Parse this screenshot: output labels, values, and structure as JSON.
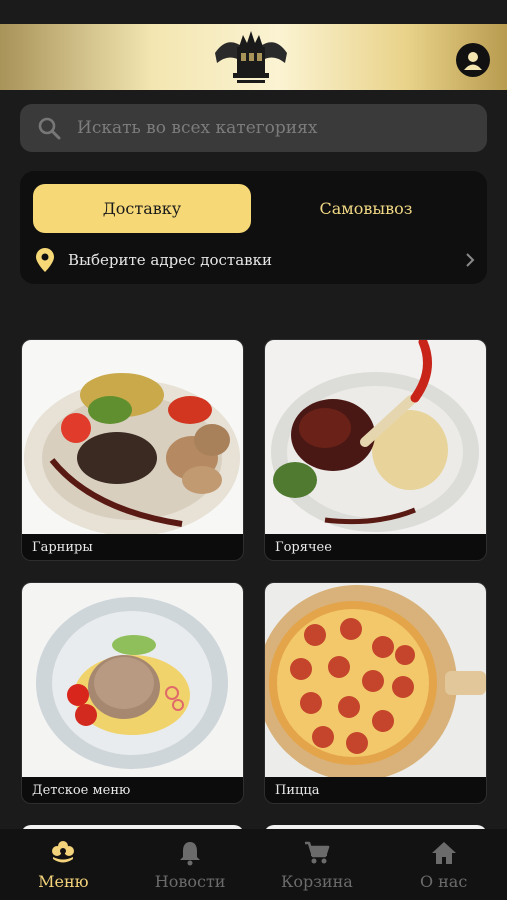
{
  "header": {
    "brand_logo": "crown-castle-logo",
    "profile_icon": "account-circle-icon"
  },
  "search": {
    "placeholder": "Искать во всех категориях",
    "icon": "search-icon"
  },
  "delivery": {
    "tab_delivery": "Доставку",
    "tab_pickup": "Самовывоз",
    "active_tab": "delivery",
    "address_prompt": "Выберите адрес доставки"
  },
  "categories": [
    {
      "label": "Гарниры",
      "image": "grilled-vegetables-photo"
    },
    {
      "label": "Горячее",
      "image": "meat-with-risotto-photo"
    },
    {
      "label": "Детское меню",
      "image": "cutlet-with-mash-photo"
    },
    {
      "label": "Пицца",
      "image": "pepperoni-pizza-photo"
    }
  ],
  "nav": {
    "items": [
      {
        "label": "Меню",
        "icon": "menu-flower-icon",
        "active": true
      },
      {
        "label": "Новости",
        "icon": "bell-icon",
        "active": false
      },
      {
        "label": "Корзина",
        "icon": "cart-icon",
        "active": false
      },
      {
        "label": "О нас",
        "icon": "home-icon",
        "active": false
      }
    ]
  },
  "colors": {
    "accent": "#f6d877",
    "background": "#1b1b1b",
    "card": "#0f0f0f",
    "nav_inactive": "#6b6b6b"
  }
}
